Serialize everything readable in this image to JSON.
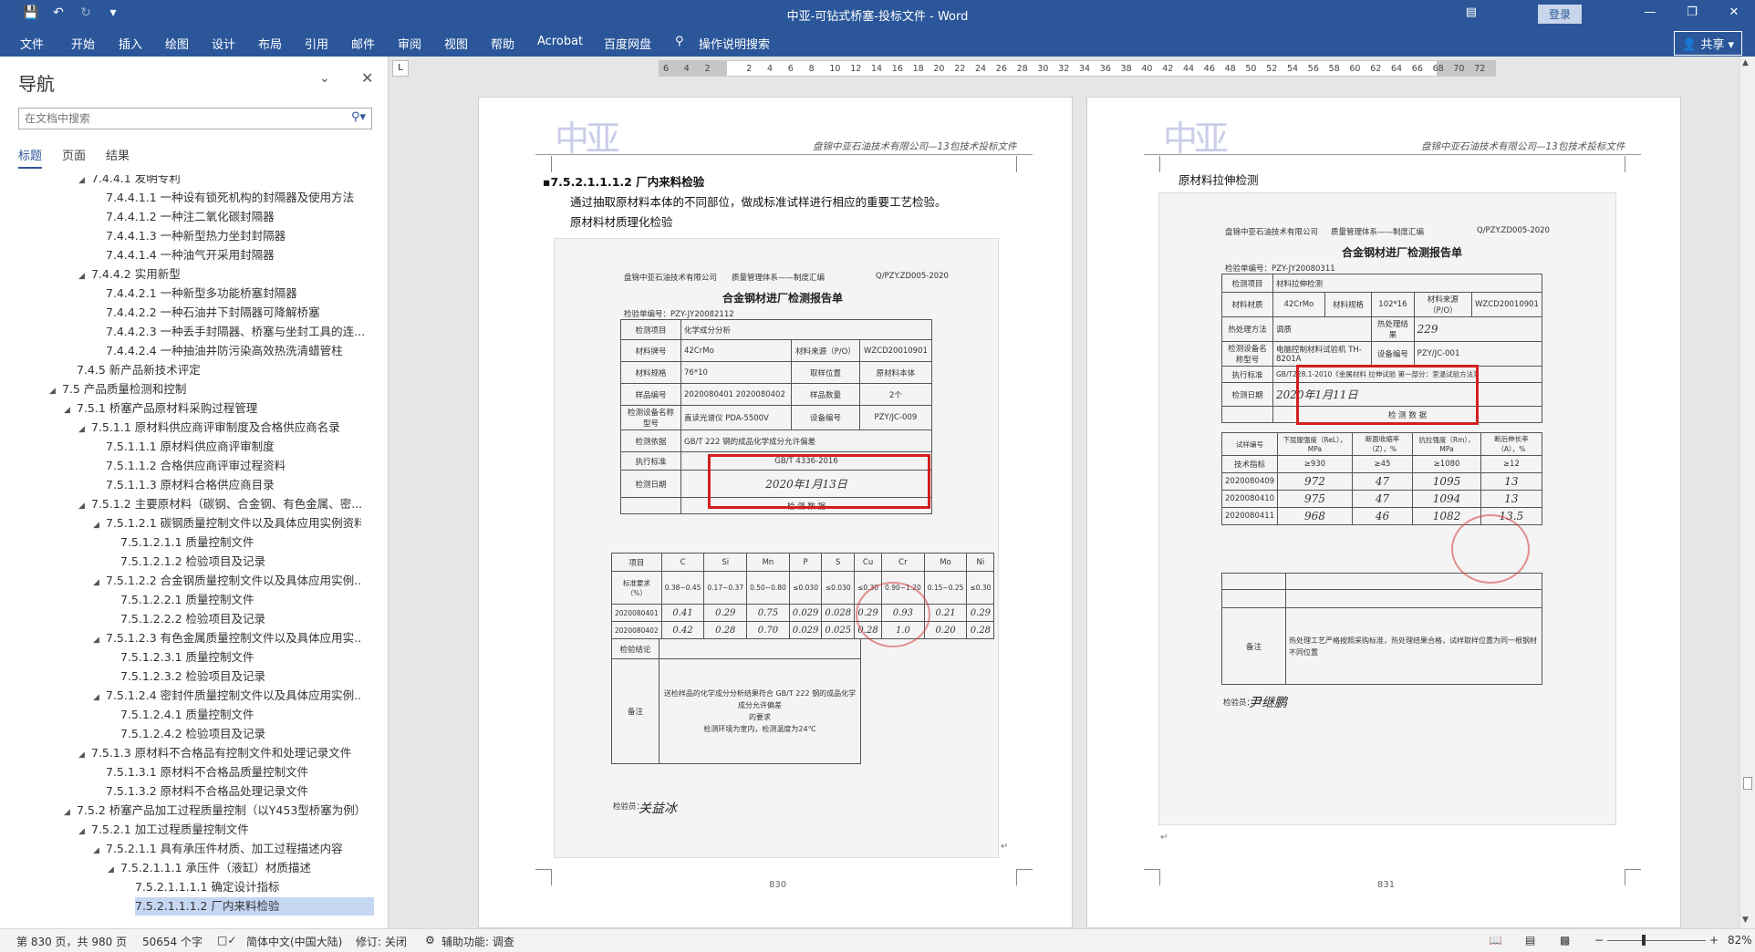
{
  "window": {
    "title": "中亚-可钻式桥塞-投标文件  -  Word",
    "login": "登录",
    "share": "共享",
    "qa_icons": [
      "save-icon",
      "undo-icon",
      "redo-icon",
      "customize-icon"
    ],
    "ribbon_options_icon": "ribbon-display-icon",
    "controls": [
      "minimize-icon",
      "restore-icon",
      "close-icon"
    ]
  },
  "menu": {
    "tabs": [
      "文件",
      "开始",
      "插入",
      "绘图",
      "设计",
      "布局",
      "引用",
      "邮件",
      "审阅",
      "视图",
      "帮助",
      "Acrobat",
      "百度网盘"
    ],
    "tell_me": "操作说明搜索"
  },
  "nav": {
    "title": "导航",
    "search_placeholder": "在文档中搜索",
    "tabs": [
      "标题",
      "页面",
      "结果"
    ],
    "items": [
      {
        "level": 3,
        "text": "7.4.4.1 发明专利",
        "arrow": "expanded"
      },
      {
        "level": 4,
        "text": "7.4.4.1.1 一种设有锁死机构的封隔器及使用方法",
        "arrow": ""
      },
      {
        "level": 4,
        "text": "7.4.4.1.2 一种注二氧化碳封隔器",
        "arrow": ""
      },
      {
        "level": 4,
        "text": "7.4.4.1.3 一种新型热力坐封封隔器",
        "arrow": ""
      },
      {
        "level": 4,
        "text": "7.4.4.1.4 一种油气开采用封隔器",
        "arrow": ""
      },
      {
        "level": 3,
        "text": "7.4.4.2 实用新型",
        "arrow": "expanded"
      },
      {
        "level": 4,
        "text": "7.4.4.2.1 一种新型多功能桥塞封隔器",
        "arrow": ""
      },
      {
        "level": 4,
        "text": "7.4.4.2.2 一种石油井下封隔器可降解桥塞",
        "arrow": ""
      },
      {
        "level": 4,
        "text": "7.4.4.2.3 一种丢手封隔器、桥塞与坐封工具的连...",
        "arrow": ""
      },
      {
        "level": 4,
        "text": "7.4.4.2.4 一种抽油井防污染高效热洗清蜡管柱",
        "arrow": ""
      },
      {
        "level": 2,
        "text": "7.4.5 新产品新技术评定",
        "arrow": ""
      },
      {
        "level": 1,
        "text": "7.5 产品质量检测和控制",
        "arrow": "expanded"
      },
      {
        "level": 2,
        "text": "7.5.1 桥塞产品原材料采购过程管理",
        "arrow": "expanded"
      },
      {
        "level": 3,
        "text": "7.5.1.1 原材料供应商评审制度及合格供应商名录",
        "arrow": "expanded"
      },
      {
        "level": 4,
        "text": "7.5.1.1.1 原材料供应商评审制度",
        "arrow": ""
      },
      {
        "level": 4,
        "text": "7.5.1.1.2 合格供应商评审过程资料",
        "arrow": ""
      },
      {
        "level": 4,
        "text": "7.5.1.1.3 原材料合格供应商目录",
        "arrow": ""
      },
      {
        "level": 3,
        "text": "7.5.1.2 主要原材料（碳钢、合金钢、有色金属、密...",
        "arrow": "expanded"
      },
      {
        "level": 4,
        "text": "7.5.1.2.1 碳钢质量控制文件以及具体应用实例资料",
        "arrow": "expanded"
      },
      {
        "level": 5,
        "text": "7.5.1.2.1.1 质量控制文件",
        "arrow": ""
      },
      {
        "level": 5,
        "text": "7.5.1.2.1.2 检验项目及记录",
        "arrow": ""
      },
      {
        "level": 4,
        "text": "7.5.1.2.2 合金钢质量控制文件以及具体应用实例...",
        "arrow": "expanded"
      },
      {
        "level": 5,
        "text": "7.5.1.2.2.1 质量控制文件",
        "arrow": ""
      },
      {
        "level": 5,
        "text": "7.5.1.2.2.2 检验项目及记录",
        "arrow": ""
      },
      {
        "level": 4,
        "text": "7.5.1.2.3 有色金属质量控制文件以及具体应用实...",
        "arrow": "expanded"
      },
      {
        "level": 5,
        "text": "7.5.1.2.3.1 质量控制文件",
        "arrow": ""
      },
      {
        "level": 5,
        "text": "7.5.1.2.3.2 检验项目及记录",
        "arrow": ""
      },
      {
        "level": 4,
        "text": "7.5.1.2.4 密封件质量控制文件以及具体应用实例...",
        "arrow": "expanded"
      },
      {
        "level": 5,
        "text": "7.5.1.2.4.1 质量控制文件",
        "arrow": ""
      },
      {
        "level": 5,
        "text": "7.5.1.2.4.2 检验项目及记录",
        "arrow": ""
      },
      {
        "level": 3,
        "text": "7.5.1.3 原材料不合格品有控制文件和处理记录文件",
        "arrow": "expanded"
      },
      {
        "level": 4,
        "text": "7.5.1.3.1 原材料不合格品质量控制文件",
        "arrow": ""
      },
      {
        "level": 4,
        "text": "7.5.1.3.2 原材料不合格品处理记录文件",
        "arrow": ""
      },
      {
        "level": 2,
        "text": "7.5.2 桥塞产品加工过程质量控制（以Y453型桥塞为例）",
        "arrow": "expanded"
      },
      {
        "level": 3,
        "text": "7.5.2.1 加工过程质量控制文件",
        "arrow": "expanded"
      },
      {
        "level": 4,
        "text": "7.5.2.1.1 具有承压件材质、加工过程描述内容",
        "arrow": "expanded"
      },
      {
        "level": 5,
        "text": "7.5.2.1.1.1 承压件（液缸）材质描述",
        "arrow": "expanded"
      },
      {
        "level": 6,
        "text": "7.5.2.1.1.1.1 确定设计指标",
        "arrow": ""
      },
      {
        "level": 6,
        "text": "7.5.2.1.1.1.2 厂内来料检验",
        "arrow": "",
        "selected": true
      }
    ]
  },
  "ruler": {
    "corner": "L",
    "ticks": [
      "6",
      "4",
      "2",
      "",
      "2",
      "4",
      "6",
      "8",
      "10",
      "12",
      "14",
      "16",
      "18",
      "20",
      "22",
      "24",
      "26",
      "28",
      "30",
      "32",
      "34",
      "36",
      "38",
      "40",
      "42",
      "44",
      "46",
      "48",
      "50",
      "52",
      "54",
      "56",
      "58",
      "60",
      "62",
      "64",
      "66",
      "68",
      "70",
      "72"
    ]
  },
  "page1": {
    "header": "盘锦中亚石油技术有限公司—13包技术投标文件",
    "heading": "▪7.5.2.1.1.1.2 厂内来料检验",
    "para1": "通过抽取原材料本体的不同部位，做成标准试样进行相应的重要工艺检验。",
    "para2": "原材料材质理化检验",
    "page_number": "830",
    "scan": {
      "company": "盘锦中亚石油技术有限公司",
      "system": "质量管理体系——制度汇编",
      "code": "Q/PZY.ZD005-2020",
      "title": "合金钢材进厂检测报告单",
      "form_no": "检验单编号：PZY-JY20082112",
      "rows": [
        [
          "检测项目",
          "化学成分分析",
          "",
          ""
        ],
        [
          "材料牌号",
          "42CrMo",
          "材料来源（P/O）",
          "WZCD20010901"
        ],
        [
          "材料规格",
          "76*10",
          "取样位置",
          "原材料本体"
        ],
        [
          "样品编号",
          "2020080401 2020080402",
          "样品数量",
          "2个"
        ],
        [
          "检测设备名称型号",
          "直读光谱仪  PDA-5500V",
          "设备编号",
          "PZY/JC-009"
        ],
        [
          "检测依据",
          "GB/T 222  钢的成品化学成分允许偏差",
          "",
          ""
        ],
        [
          "执行标准",
          "GB/T 4336-2016",
          "",
          ""
        ]
      ],
      "date_label": "检测日期",
      "date_value": "2020年1月13日",
      "data_label": "检 测 数 据",
      "elements": [
        "项目",
        "C",
        "Si",
        "Mn",
        "P",
        "S",
        "Cu",
        "Cr",
        "Mo",
        "Ni"
      ],
      "standard_label": "标准要求（%）",
      "standard": [
        "0.38~0.45",
        "0.17~0.37",
        "0.50~0.80",
        "≤0.030",
        "≤0.030",
        "≤0.30",
        "0.90~1.20",
        "0.15~0.25",
        "≤0.30"
      ],
      "samples": [
        {
          "id": "2020080401",
          "values": [
            "0.41",
            "0.29",
            "0.75",
            "0.029",
            "0.028",
            "0.29",
            "0.93",
            "0.21",
            "0.29"
          ]
        },
        {
          "id": "2020080402",
          "values": [
            "0.42",
            "0.28",
            "0.70",
            "0.029",
            "0.025",
            "0.28",
            "1.0",
            "0.20",
            "0.28"
          ]
        }
      ],
      "conclusion_label": "检验结论",
      "remark_label": "备注",
      "remark1": "送检样品的化学成分分析结果符合 GB/T 222  钢的成品化学成分允许偏差",
      "remark2": "的要求",
      "remark3": "检测环境为室内，检测温度为24℃",
      "inspector_label": "检验员：",
      "inspector_sig": "关益冰"
    }
  },
  "page2": {
    "header": "盘锦中亚石油技术有限公司—13包技术投标文件",
    "para1": "原材料拉伸检测",
    "page_number": "831",
    "scan": {
      "company": "盘锦中亚石油技术有限公司",
      "system": "质量管理体系——制度汇编",
      "code": "Q/PZY.ZD005-2020",
      "title": "合金钢材进厂检测报告单",
      "form_no": "检验单编号：PZY-JY20080311",
      "rows": [
        [
          "检测项目",
          "材料拉伸检测",
          "",
          "",
          "",
          ""
        ],
        [
          "材料材质",
          "42CrMo",
          "材料规格",
          "102*16",
          "材料来源（P/O）",
          "WZCD20010901"
        ],
        [
          "热处理方法",
          "调质",
          "热处理结果",
          "229",
          "",
          ""
        ],
        [
          "检测设备名称型号",
          "电脑控制材料试验机 TH-8201A",
          "设备编号",
          "PZY/JC-001",
          "",
          ""
        ],
        [
          "执行标准",
          "GB/T228.1-2010《金属材料 拉伸试验 第一部分：室温试验方法》",
          "",
          "",
          "",
          ""
        ]
      ],
      "date_label": "检测日期",
      "date_value": "2020年1月11日",
      "data_label": "检 测 数 据",
      "props": [
        "试样编号",
        "下屈服强度（ReL），MPa",
        "断面收缩率（Z），%",
        "抗拉强度（Rm），MPa",
        "断后伸长率（A），%"
      ],
      "spec_label": "技术指标",
      "spec": [
        "≥930",
        "≥45",
        "≥1080",
        "≥12"
      ],
      "samples": [
        {
          "id": "2020080409",
          "values": [
            "972",
            "47",
            "1095",
            "13"
          ]
        },
        {
          "id": "2020080410",
          "values": [
            "975",
            "47",
            "1094",
            "13"
          ]
        },
        {
          "id": "2020080411",
          "values": [
            "968",
            "46",
            "1082",
            "13.5"
          ]
        }
      ],
      "remark_label": "备注",
      "remark": "热处理工艺严格按照采购标准，热处理结果合格，试样取样位置为同一根钢材不同位置",
      "inspector_label": "检验员：",
      "inspector_sig": "尹继鹏"
    }
  },
  "status": {
    "page": "第 830 页，共 980 页",
    "words": "50654 个字",
    "proof_icon": "proofing-icon",
    "language": "简体中文(中国大陆)",
    "track": "修订: 关闭",
    "accessibility": "辅助功能: 调查",
    "zoom": "82%",
    "zoom_minus": "−",
    "zoom_plus": "+"
  }
}
